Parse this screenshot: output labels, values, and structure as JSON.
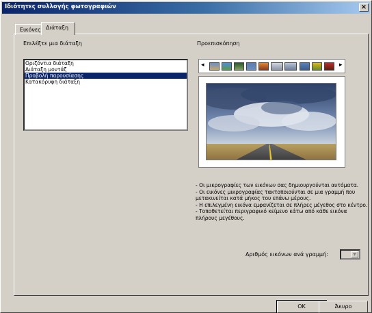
{
  "window": {
    "title": "Ιδιότητες συλλογής φωτογραφιών",
    "close_label": "×"
  },
  "tabs": [
    {
      "label": "Εικόνες"
    },
    {
      "label": "Διάταξη"
    }
  ],
  "layout_section": {
    "heading": "Επιλέξτε μια διάταξη",
    "options": [
      "Οριζόντια διάταξη",
      "Διάταξη μοντάζ",
      "Προβολή παρουσίασης",
      "Κατακόρυφη διάταξη"
    ],
    "selected_index": 2
  },
  "preview_section": {
    "heading": "Προεπισκόπηση",
    "prev_arrow": "◂",
    "next_arrow": "▸",
    "thumbnail_count": 10
  },
  "description": [
    "- Οι μικρογραφίες των εικόνων σας δημιουργούνται αυτόματα.",
    "- Οι εικόνες μικρογραφίας τακτοποιούνται σε μια γραμμή που μετακινείται κατά μήκος του επάνω μέρους.",
    "- Η επιλεγμένη εικόνα εμφανίζεται σε πλήρες μέγεθος στο κέντρο.",
    "- Τοποθετείται περιγραφικό κείμενο κάτω από κάθε εικόνα πλήρους μεγέθους."
  ],
  "images_per_row": {
    "label": "Αριθμός εικόνων ανά γραμμή:",
    "value": "",
    "dropdown_icon": "▼"
  },
  "buttons": {
    "ok": "OK",
    "cancel": "Άκυρο"
  }
}
